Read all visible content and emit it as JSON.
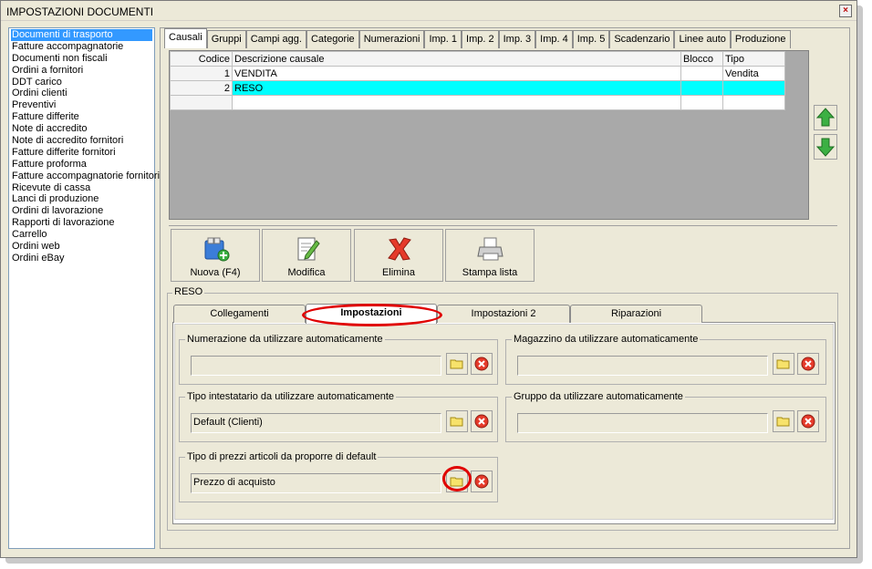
{
  "window": {
    "title": "IMPOSTAZIONI DOCUMENTI",
    "close": "×"
  },
  "sidebar": {
    "items": [
      "Documenti di trasporto",
      "Fatture accompagnatorie",
      "Documenti non fiscali",
      "Ordini a fornitori",
      "DDT carico",
      "Ordini clienti",
      "Preventivi",
      "Fatture differite",
      "Note di accredito",
      "Note di accredito fornitori",
      "Fatture differite fornitori",
      "Fatture proforma",
      "Fatture accompagnatorie fornitori",
      "Ricevute di cassa",
      "Lanci di produzione",
      "Ordini di lavorazione",
      "Rapporti di lavorazione",
      "Carrello",
      "Ordini web",
      "Ordini eBay"
    ],
    "selected_index": 0
  },
  "tabs": [
    "Causali",
    "Gruppi",
    "Campi agg.",
    "Categorie",
    "Numerazioni",
    "Imp. 1",
    "Imp. 2",
    "Imp. 3",
    "Imp. 4",
    "Imp. 5",
    "Scadenzario",
    "Linee auto",
    "Produzione"
  ],
  "grid": {
    "headers": [
      "Codice",
      "Descrizione causale",
      "Blocco",
      "Tipo"
    ],
    "rows": [
      {
        "codice": "1",
        "descrizione": "VENDITA",
        "blocco": "",
        "tipo": "Vendita"
      },
      {
        "codice": "2",
        "descrizione": "RESO",
        "blocco": "",
        "tipo": ""
      }
    ]
  },
  "toolbar": {
    "new": "Nuova (F4)",
    "edit": "Modifica",
    "delete": "Elimina",
    "print": "Stampa lista"
  },
  "group": {
    "title": "RESO"
  },
  "inner_tabs": [
    "Collegamenti",
    "Impostazioni",
    "Impostazioni 2",
    "Riparazioni"
  ],
  "fields": {
    "numerazione": {
      "label": "Numerazione da utilizzare automaticamente",
      "value": ""
    },
    "magazzino": {
      "label": "Magazzino da utilizzare automaticamente",
      "value": ""
    },
    "intestatario": {
      "label": "Tipo intestatario da utilizzare automaticamente",
      "value": "Default (Clienti)"
    },
    "gruppo": {
      "label": "Gruppo da utilizzare automaticamente",
      "value": ""
    },
    "prezzi": {
      "label": "Tipo di prezzi articoli da proporre di default",
      "value": "Prezzo di acquisto"
    }
  },
  "colors": {
    "selection": "#3399ff",
    "highlight_row": "#00ffff",
    "annotation": "#e00000"
  },
  "icons": [
    "close-icon",
    "arrow-up-icon",
    "arrow-down-icon",
    "new-document-icon",
    "edit-icon",
    "delete-x-icon",
    "printer-icon",
    "folder-icon",
    "clear-icon"
  ]
}
